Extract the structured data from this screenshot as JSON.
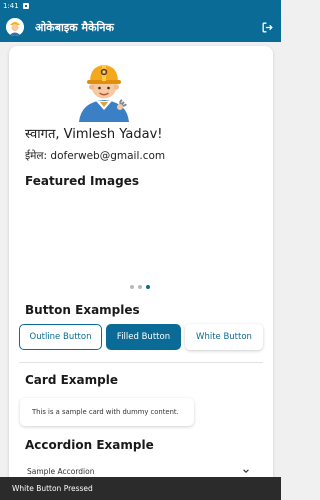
{
  "status_bar": {
    "time": "1:41"
  },
  "app_bar": {
    "title": "ओकेबाइक मैकेनिक"
  },
  "profile": {
    "welcome": "स्वागत, Vimlesh Yadav!",
    "email": "ईमेल: doferweb@gmail.com"
  },
  "sections": {
    "featured_images": "Featured Images",
    "button_examples": "Button Examples",
    "card_example": "Card Example",
    "accordion_example": "Accordion Example"
  },
  "carousel": {
    "page_count": 3,
    "active_index": 2
  },
  "buttons": {
    "outline": "Outline Button",
    "filled": "Filled Button",
    "white": "White Button"
  },
  "card": {
    "content": "This is a sample card with dummy content."
  },
  "accordion": {
    "title": "Sample Accordion"
  },
  "snackbar": {
    "message": "White Button Pressed"
  },
  "colors": {
    "primary": "#0a6b96",
    "snackbar": "#2b2b2b"
  },
  "icons": {
    "logout": "logout-icon",
    "avatar": "mechanic-avatar",
    "expand": "chevron-down-icon"
  }
}
